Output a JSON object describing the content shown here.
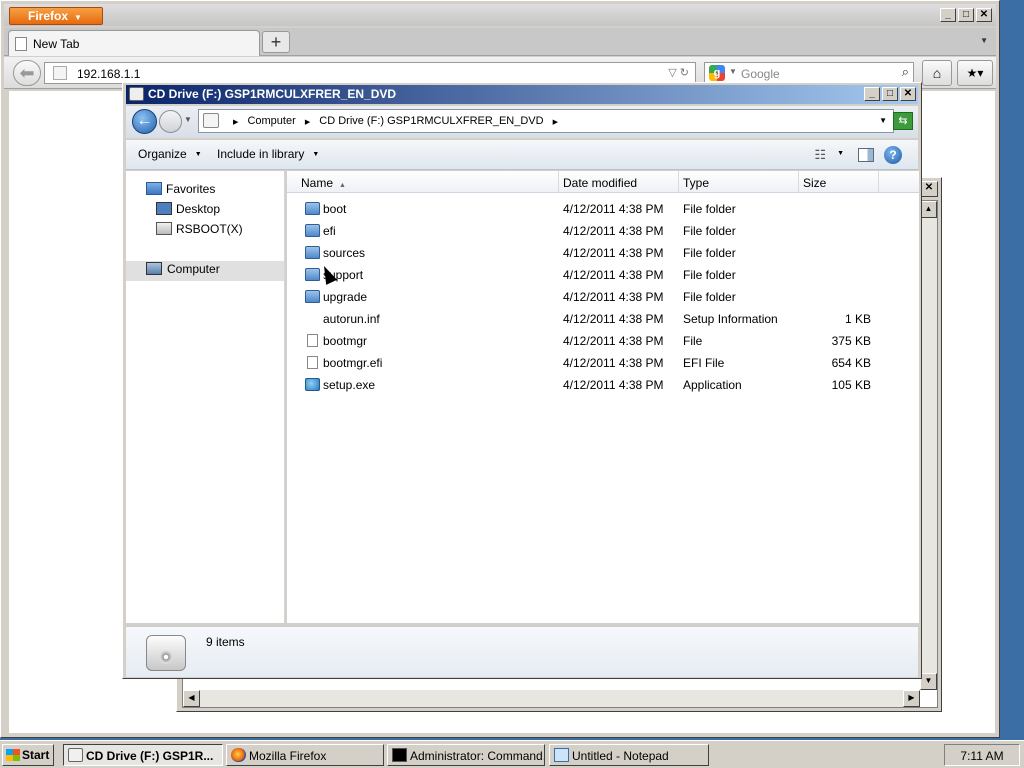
{
  "firefox": {
    "menu_label": "Firefox",
    "tab_title": "New Tab",
    "new_tab_symbol": "+",
    "url": "192.168.1.1",
    "search_placeholder": "Google"
  },
  "explorer": {
    "title": "CD Drive (F:) GSP1RMCULXFRER_EN_DVD",
    "breadcrumb": [
      "Computer",
      "CD Drive (F:) GSP1RMCULXFRER_EN_DVD"
    ],
    "toolbar": {
      "organize": "Organize",
      "include": "Include in library"
    },
    "nav": {
      "favorites": "Favorites",
      "desktop": "Desktop",
      "rsboot": "RSBOOT(X)",
      "computer": "Computer"
    },
    "columns": {
      "name": "Name",
      "date": "Date modified",
      "type": "Type",
      "size": "Size"
    },
    "files": [
      {
        "name": "boot",
        "date": "4/12/2011 4:38 PM",
        "type": "File folder",
        "size": "",
        "icon": "folder-icon"
      },
      {
        "name": "efi",
        "date": "4/12/2011 4:38 PM",
        "type": "File folder",
        "size": "",
        "icon": "folder-icon"
      },
      {
        "name": "sources",
        "date": "4/12/2011 4:38 PM",
        "type": "File folder",
        "size": "",
        "icon": "folder-icon"
      },
      {
        "name": "support",
        "date": "4/12/2011 4:38 PM",
        "type": "File folder",
        "size": "",
        "icon": "folder-icon"
      },
      {
        "name": "upgrade",
        "date": "4/12/2011 4:38 PM",
        "type": "File folder",
        "size": "",
        "icon": "folder-icon"
      },
      {
        "name": "autorun.inf",
        "date": "4/12/2011 4:38 PM",
        "type": "Setup Information",
        "size": "1 KB",
        "icon": "settings-file-icon"
      },
      {
        "name": "bootmgr",
        "date": "4/12/2011 4:38 PM",
        "type": "File",
        "size": "375 KB",
        "icon": "file-icon"
      },
      {
        "name": "bootmgr.efi",
        "date": "4/12/2011 4:38 PM",
        "type": "EFI File",
        "size": "654 KB",
        "icon": "file-icon"
      },
      {
        "name": "setup.exe",
        "date": "4/12/2011 4:38 PM",
        "type": "Application",
        "size": "105 KB",
        "icon": "application-icon"
      }
    ],
    "item_count": "9 items"
  },
  "taskbar": {
    "start": "Start",
    "tasks": [
      "CD Drive (F:) GSP1R...",
      "Mozilla Firefox",
      "Administrator: Command...",
      "Untitled - Notepad"
    ],
    "clock": "7:11 AM"
  },
  "colors": {
    "title_gradient_start": "#0a246a",
    "title_gradient_end": "#a6caf0",
    "firefox_orange": "#e66a10",
    "desktop": "#3a6ea5"
  }
}
